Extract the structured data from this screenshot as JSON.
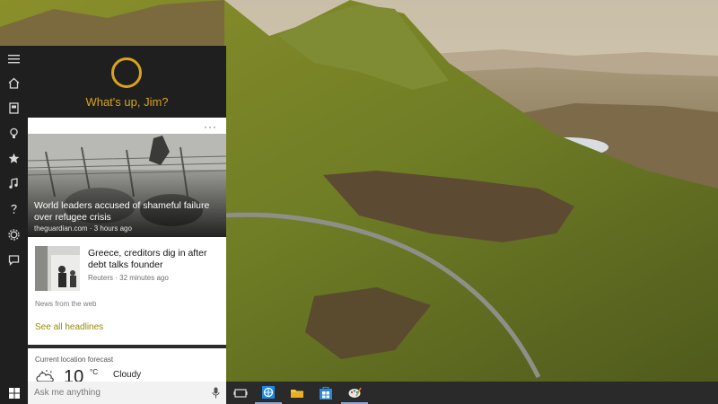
{
  "cortana": {
    "greeting": "What's up, Jim?",
    "more_label": "···",
    "news": [
      {
        "headline": "World leaders accused of shameful failure over refugee crisis",
        "source": "theguardian.com · 3 hours ago"
      },
      {
        "headline": "Greece, creditors dig in after debt talks founder",
        "source": "Reuters · 32 minutes ago"
      }
    ],
    "news_footer": "News from the web",
    "see_all": "See all headlines",
    "forecast": {
      "title": "Current location forecast",
      "temperature": "10",
      "unit": "°C",
      "condition": "Cloudy"
    }
  },
  "rail_icons": [
    "hamburger-menu-icon",
    "home-icon",
    "notebook-icon",
    "lightbulb-icon",
    "star-icon",
    "music-icon",
    "help-icon",
    "settings-icon",
    "feedback-icon"
  ],
  "taskbar": {
    "search_placeholder": "Ask me anything",
    "pinned": [
      "task-view-icon",
      "ie-icon",
      "file-explorer-icon",
      "store-icon",
      "paint-icon"
    ]
  },
  "colors": {
    "accent": "#d9a41a",
    "panel_bg": "#1f1f1f",
    "taskbar_bg": "#2a2a2a",
    "link": "#9a8a00"
  }
}
